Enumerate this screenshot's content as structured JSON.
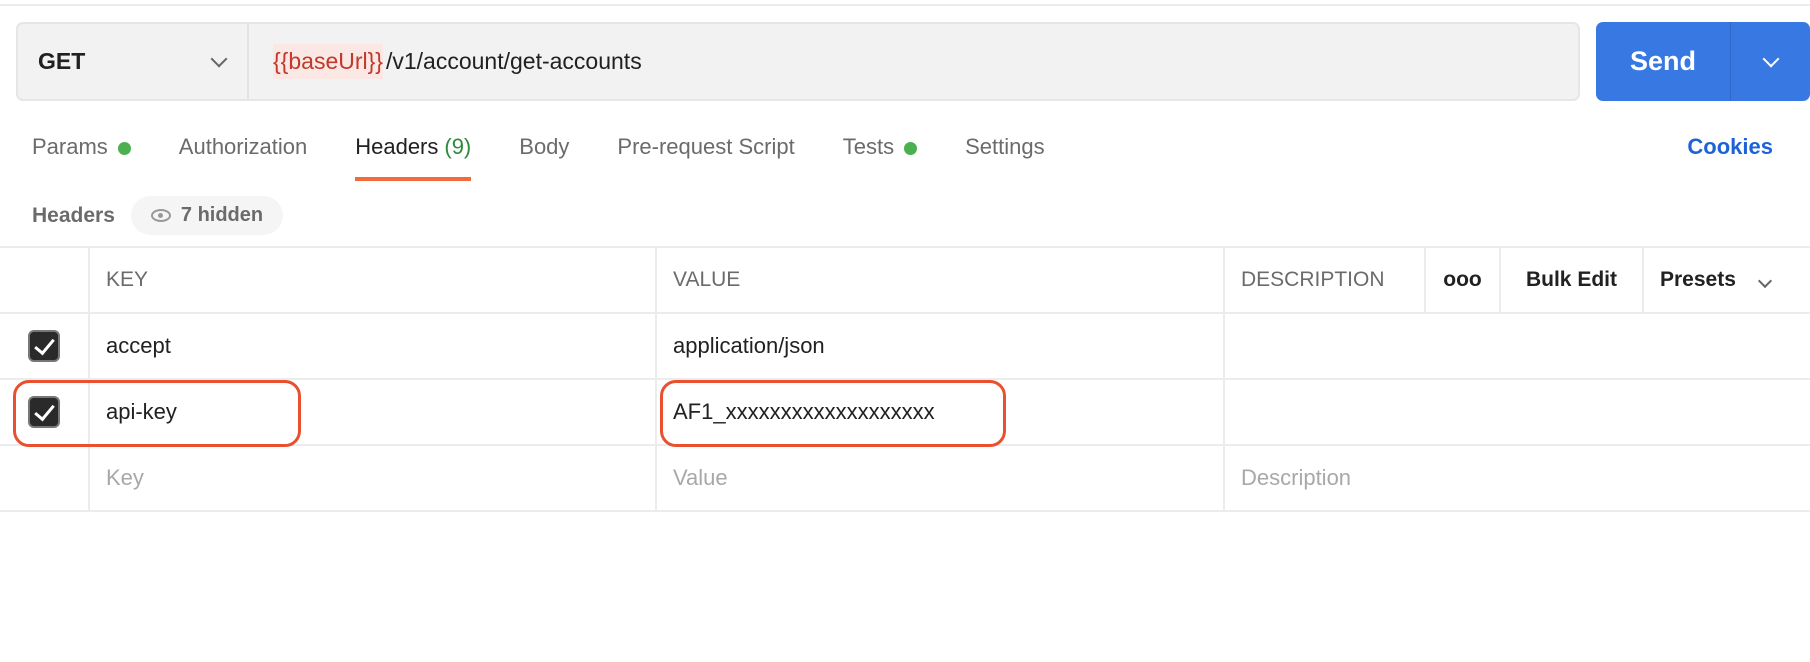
{
  "request": {
    "method": "GET",
    "url_variable": "{{baseUrl}}",
    "url_path": "/v1/account/get-accounts",
    "send_label": "Send"
  },
  "tabs": [
    {
      "label": "Params",
      "dot": true
    },
    {
      "label": "Authorization"
    },
    {
      "label": "Headers",
      "count": "(9)",
      "active": true
    },
    {
      "label": "Body"
    },
    {
      "label": "Pre-request Script"
    },
    {
      "label": "Tests",
      "dot": true
    },
    {
      "label": "Settings"
    }
  ],
  "cookies_label": "Cookies",
  "headers_section": {
    "title": "Headers",
    "hidden_label": "7 hidden"
  },
  "table": {
    "columns": [
      "KEY",
      "VALUE",
      "DESCRIPTION"
    ],
    "more_label": "ooo",
    "bulk_edit": "Bulk Edit",
    "presets": "Presets",
    "rows": [
      {
        "checked": true,
        "key": "accept",
        "value": "application/json",
        "description": ""
      },
      {
        "checked": true,
        "key": "api-key",
        "value": "AF1_xxxxxxxxxxxxxxxxxxx",
        "description": ""
      }
    ],
    "placeholders": {
      "key": "Key",
      "value": "Value",
      "description": "Description"
    }
  },
  "colors": {
    "accent": "#3778e2",
    "highlight": "#e8502f",
    "tab_underline": "#f26b3a"
  }
}
